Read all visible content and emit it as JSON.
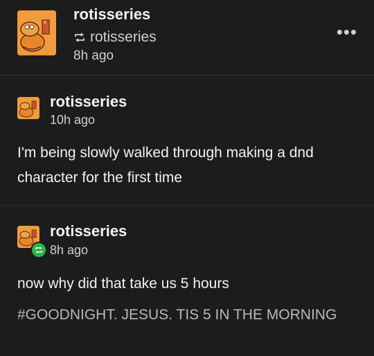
{
  "header": {
    "username": "rotisseries",
    "reblogged_from": "rotisseries",
    "time": "8h ago",
    "avatar_icon": "cartoon-cat-avatar",
    "reblog_icon": "reblog-icon",
    "more_icon": "more-options-icon",
    "more_label": "•••"
  },
  "posts": [
    {
      "username": "rotisseries",
      "time": "10h ago",
      "body": "I'm being slowly walked through making a dnd character for the first time"
    },
    {
      "username": "rotisseries",
      "time": "8h ago",
      "body": "now why did that take us 5 hours",
      "tags": "#GOODNIGHT. JESUS.  TIS 5 IN THE MORNING"
    }
  ],
  "colors": {
    "background": "#1c1c1c",
    "avatar_orange": "#f29b3c",
    "reblog_badge_green": "#2fb34a"
  }
}
